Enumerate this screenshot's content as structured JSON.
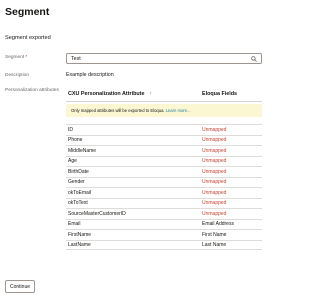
{
  "page": {
    "title": "Segment",
    "subtitle": "Segment exported"
  },
  "form": {
    "segment_label": "Segment",
    "required_marker": "*",
    "segment_value": "Test",
    "description_label": "Description",
    "description_value": "Example description",
    "attributes_label": "Personalization attributes"
  },
  "table": {
    "columns": [
      "CXU Personalization Attribute",
      "Eloqua Fields"
    ],
    "sort_glyph": "↑",
    "notice_text": "Only mapped attributes will be exported to Eloqua.",
    "notice_link": "Learn more..."
  },
  "rows": [
    {
      "attribute": "ID",
      "field": "Unmapped",
      "mapped": false
    },
    {
      "attribute": "Phone",
      "field": "Unmapped",
      "mapped": false
    },
    {
      "attribute": "MiddleName",
      "field": "Unmapped",
      "mapped": false
    },
    {
      "attribute": "Age",
      "field": "Unmapped",
      "mapped": false
    },
    {
      "attribute": "BirthDate",
      "field": "Unmapped",
      "mapped": false
    },
    {
      "attribute": "Gender",
      "field": "Unmapped",
      "mapped": false
    },
    {
      "attribute": "okToEmail",
      "field": "Unmapped",
      "mapped": false
    },
    {
      "attribute": "okToText",
      "field": "Unmapped",
      "mapped": false
    },
    {
      "attribute": "SourceMasterCustomerID",
      "field": "Unmapped",
      "mapped": false
    },
    {
      "attribute": "Email",
      "field": "Email Address",
      "mapped": true
    },
    {
      "attribute": "FirstName",
      "field": "First Name",
      "mapped": true
    },
    {
      "attribute": "LastName",
      "field": "Last Name",
      "mapped": true
    }
  ],
  "footer": {
    "continue_label": "Continue"
  },
  "colors": {
    "unmapped": "#c74634",
    "notice_bg": "#fbf7d3",
    "link": "#227e9e"
  },
  "icons": {
    "search": "search-icon"
  }
}
